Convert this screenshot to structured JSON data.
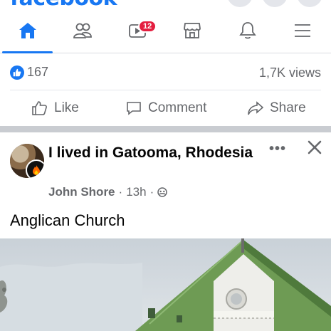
{
  "app": {
    "logo_text": "facebook"
  },
  "nav": {
    "items": [
      {
        "name": "home",
        "active": true
      },
      {
        "name": "friends"
      },
      {
        "name": "watch",
        "badge": "12"
      },
      {
        "name": "marketplace"
      },
      {
        "name": "notifications"
      },
      {
        "name": "menu"
      }
    ],
    "accent_color": "#1877f2",
    "badge_color": "#e41e3f"
  },
  "stats": {
    "likes_count": "167",
    "views": "1,7K views"
  },
  "actions": {
    "like": "Like",
    "comment": "Comment",
    "share": "Share"
  },
  "post": {
    "group_name": "I lived in Gatooma, Rhodesia",
    "author": "John Shore",
    "time": "13h",
    "separator": "·",
    "privacy_icon": "group-privacy-icon",
    "text": "Anglican Church",
    "more_label": "•••"
  }
}
